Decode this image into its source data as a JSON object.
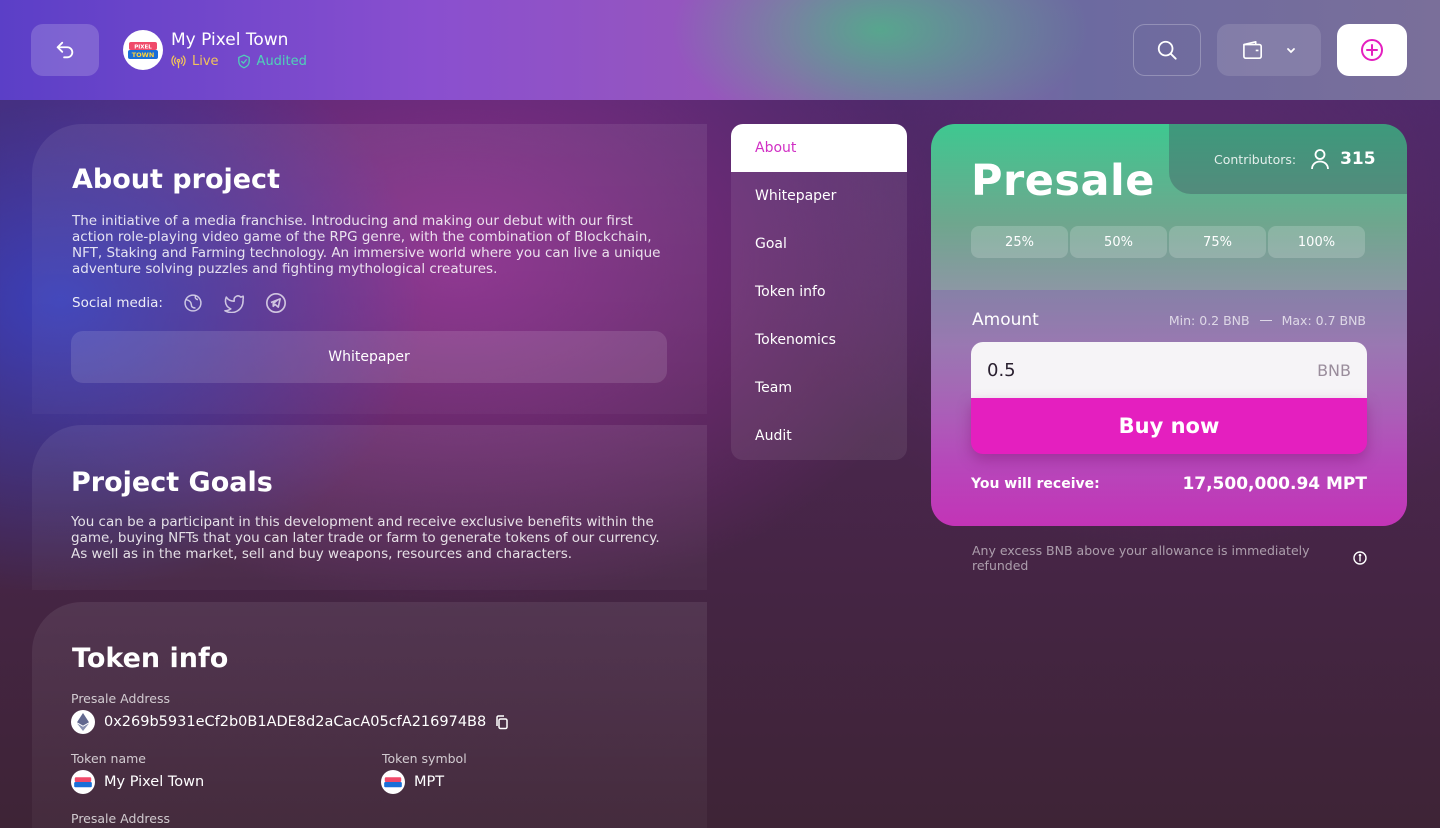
{
  "header": {
    "app_title": "My Pixel Town",
    "status_live": "Live",
    "status_audited": "Audited",
    "logo_text": "PIXEL TOWN"
  },
  "about": {
    "title": "About project",
    "description": "The initiative of a media franchise. Introducing and making our debut with our first action role-playing video game of the RPG genre, with the combination of Blockchain, NFT, Staking and Farming technology. An immersive world where you can live a unique adventure solving puzzles and fighting mythological creatures.",
    "social_label": "Social media:",
    "whitepaper_button": "Whitepaper"
  },
  "goals": {
    "title": "Project Goals",
    "description": "You can be a participant in this development and receive exclusive benefits within the game, buying NFTs that you can later trade or farm to generate tokens of our currency. As well as in the market, sell and buy weapons, resources and characters."
  },
  "token_info": {
    "title": "Token info",
    "presale_address_label": "Presale Address",
    "presale_address": "0x269b5931eCf2b0B1ADE8d2aCacA05cfA216974B8",
    "token_name_label": "Token name",
    "token_name": "My Pixel Town",
    "token_symbol_label": "Token symbol",
    "token_symbol": "MPT",
    "presale_address_label_2": "Presale Address"
  },
  "sidenav": {
    "items": [
      "About",
      "Whitepaper",
      "Goal",
      "Token info",
      "Tokenomics",
      "Team",
      "Audit"
    ]
  },
  "presale": {
    "title": "Presale",
    "contributors_label": "Contributors:",
    "contributors_count": "315",
    "percent_buttons": [
      "25%",
      "50%",
      "75%",
      "100%"
    ],
    "amount_label": "Amount",
    "min_label": "Min: 0.2 BNB",
    "max_label": "Max: 0.7 BNB",
    "amount_value": "0.5",
    "amount_unit": "BNB",
    "buy_button": "Buy now",
    "receive_label": "You will receive:",
    "receive_value": "17,500,000.94 MPT",
    "refund_note": "Any excess BNB above your allowance is immediately refunded"
  },
  "colors": {
    "accent_pink": "#e41fbf",
    "presale_green": "#3ec890",
    "live_yellow": "#f2c45a",
    "audited_teal": "#4fd2b8"
  }
}
